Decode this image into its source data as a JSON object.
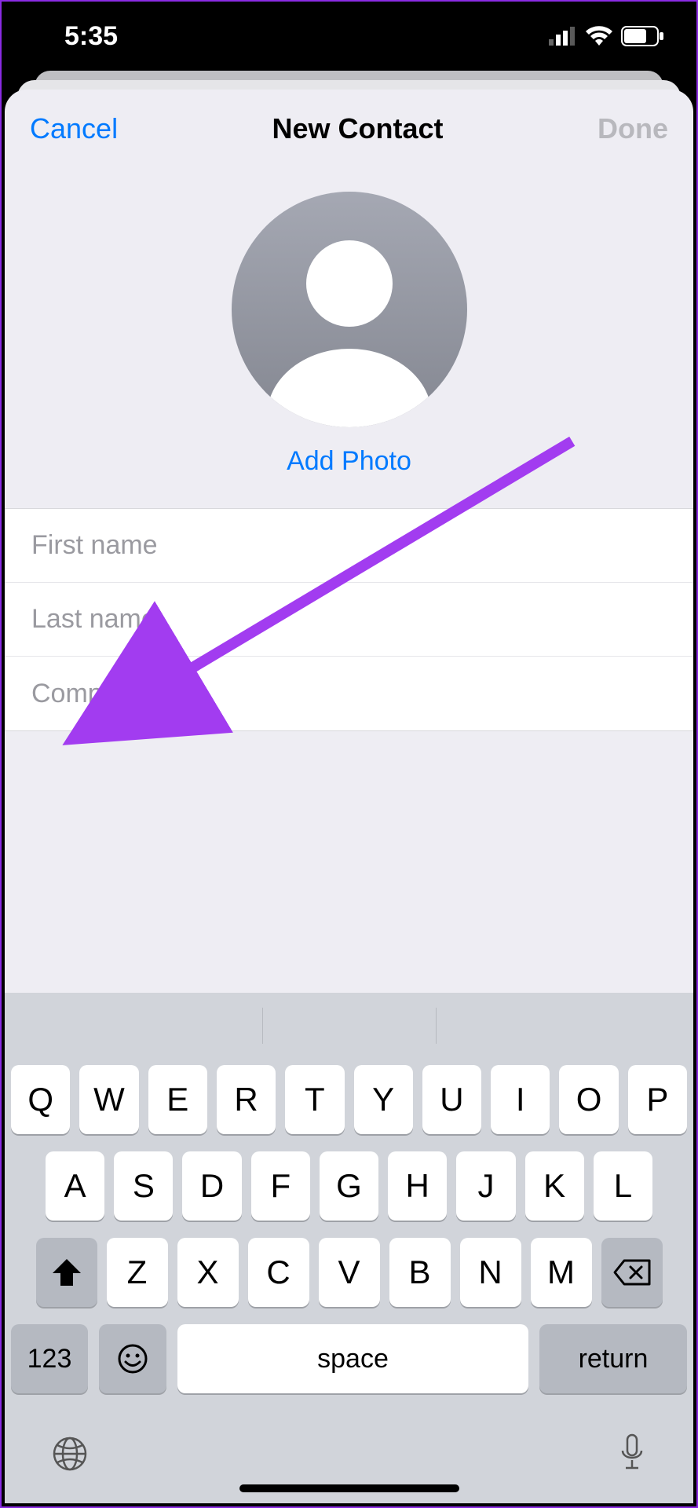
{
  "status_bar": {
    "time": "5:35"
  },
  "nav": {
    "cancel": "Cancel",
    "title": "New Contact",
    "done": "Done"
  },
  "photo": {
    "add_photo": "Add Photo"
  },
  "fields": {
    "first_name": {
      "placeholder": "First name",
      "value": ""
    },
    "last_name": {
      "placeholder": "Last name",
      "value": ""
    },
    "company": {
      "placeholder": "Company",
      "value": ""
    }
  },
  "keyboard": {
    "row1": [
      "Q",
      "W",
      "E",
      "R",
      "T",
      "Y",
      "U",
      "I",
      "O",
      "P"
    ],
    "row2": [
      "A",
      "S",
      "D",
      "F",
      "G",
      "H",
      "J",
      "K",
      "L"
    ],
    "row3": [
      "Z",
      "X",
      "C",
      "V",
      "B",
      "N",
      "M"
    ],
    "numbers_key": "123",
    "space": "space",
    "return": "return"
  }
}
